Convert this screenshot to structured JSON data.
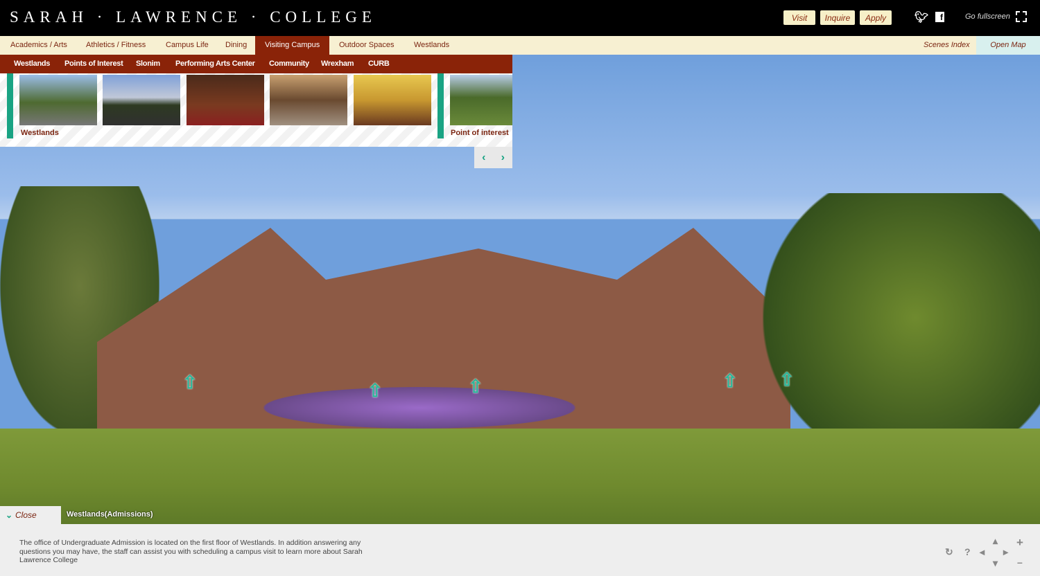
{
  "header": {
    "logo": "SARAH · LAWRENCE · COLLEGE",
    "buttons": [
      "Visit",
      "Inquire",
      "Apply"
    ],
    "fullscreen_label": "Go fullscreen"
  },
  "menu": {
    "items": [
      "Academics / Arts",
      "Athletics / Fitness",
      "Campus Life",
      "Dining",
      "Visiting Campus",
      "Outdoor Spaces",
      "Westlands"
    ],
    "active": "Visiting Campus",
    "scenes_index": "Scenes Index",
    "open_map": "Open Map"
  },
  "submenu": {
    "items": [
      "Westlands",
      "Points of Interest",
      "Slonim",
      "Performing Arts Center",
      "Community",
      "Wrexham",
      "CURB"
    ]
  },
  "thumbnails": {
    "group1_label": "Westlands",
    "group2_label": "Point of interest"
  },
  "scene": {
    "close_label": "Close",
    "title": "Westlands(Admissions)",
    "description": "The office of Undergraduate Admission is located on the first floor of Westlands. In addition answering any questions you may have, the staff can assist you with scheduling a campus visit to learn more about Sarah Lawrence College"
  },
  "colors": {
    "brand": "#8a2308",
    "accent": "#1aa383",
    "menu_bg": "#f7f0d2"
  }
}
